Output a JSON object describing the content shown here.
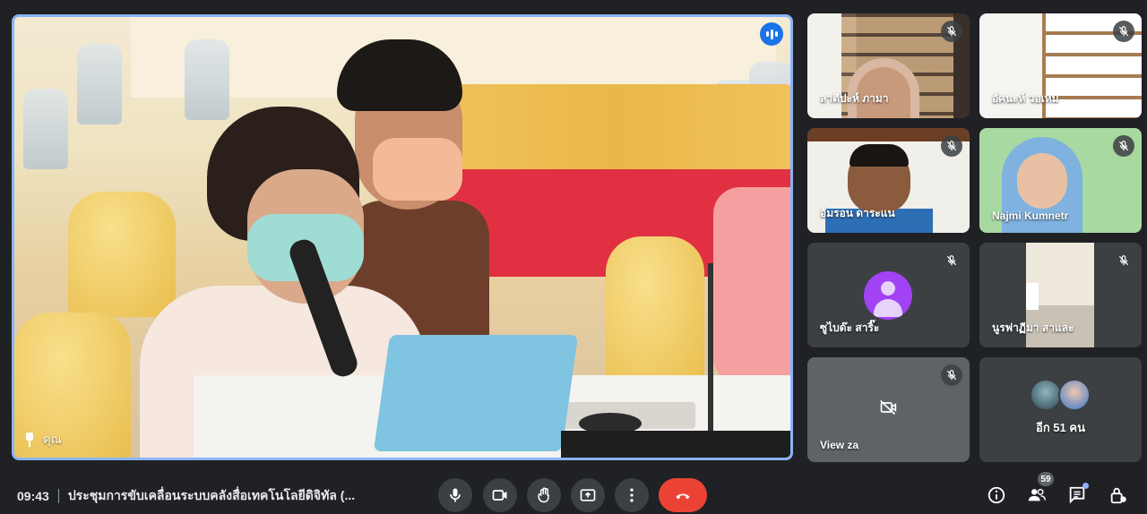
{
  "main_speaker": {
    "name": "คุณ"
  },
  "participants": [
    {
      "name": "ลาตีปะห์ ภามา",
      "muted": true
    },
    {
      "name": "อัศนะห์ วอเหม",
      "muted": true
    },
    {
      "name": "อัมรอน ดาระแน",
      "muted": true
    },
    {
      "name": "Najmi Kumnetr",
      "muted": true
    },
    {
      "name": "ซูไบด๊ะ สาริ๊ะ",
      "muted": true
    },
    {
      "name": "นูรฟาฏีมา สาและ",
      "muted": true
    },
    {
      "name": "View za",
      "muted": true,
      "camera_off": true
    }
  ],
  "others": {
    "label": "อีก 51 คน"
  },
  "bottom_bar": {
    "time": "09:43",
    "meeting_title": "ประชุมการขับเคลื่อนระบบคลังสื่อเทคโนโลยีดิจิทัล (...",
    "people_count": "59"
  },
  "colors": {
    "accent": "#8ab4f8",
    "end_call": "#ea4335",
    "avatar": "#a142f4"
  }
}
